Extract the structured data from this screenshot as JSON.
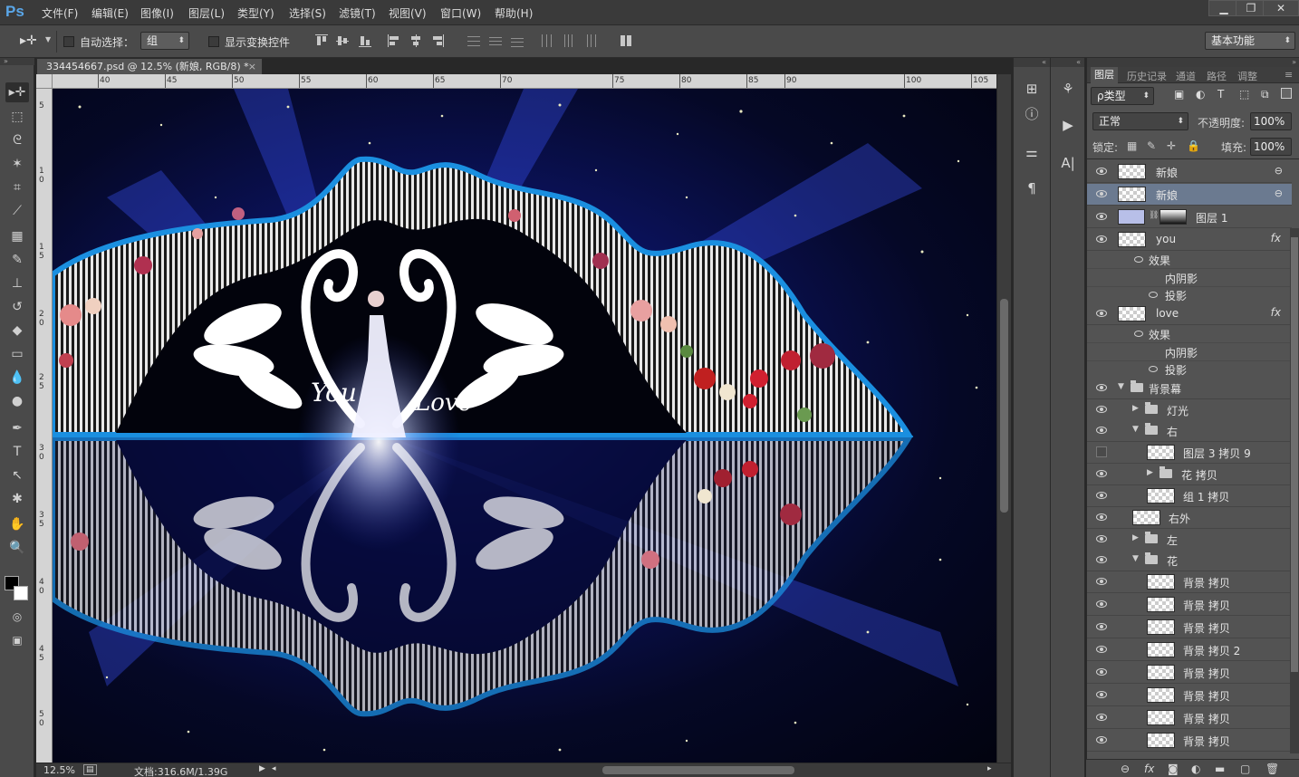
{
  "menubar": {
    "logo": "Ps",
    "items": [
      "文件(F)",
      "编辑(E)",
      "图像(I)",
      "图层(L)",
      "类型(Y)",
      "选择(S)",
      "滤镜(T)",
      "视图(V)",
      "窗口(W)",
      "帮助(H)"
    ],
    "window_buttons": [
      "minimize-icon",
      "restore-icon",
      "close-icon"
    ]
  },
  "options": {
    "auto_select_label": "自动选择：",
    "auto_select_value": "组",
    "show_transform_label": "显示变换控件",
    "workspace": "基本功能"
  },
  "document": {
    "tab_title": "334454667.psd @ 12.5% (新娘, RGB/8) *",
    "zoom": "12.5%",
    "doc_size": "文档:316.6M/1.39G"
  },
  "ruler": {
    "h_ticks": [
      "40",
      "45",
      "50",
      "55",
      "60",
      "65",
      "70",
      "75",
      "80",
      "85",
      "90",
      "100",
      "105"
    ],
    "v_ticks": [
      "5",
      "1\n0",
      "1\n5",
      "2\n0",
      "2\n5",
      "3\n0",
      "3\n5",
      "4\n0",
      "4\n5",
      "5\n0"
    ]
  },
  "layers_panel": {
    "tabs": [
      "图层",
      "历史记录",
      "通道",
      "路径",
      "调整"
    ],
    "filter_label": "ρ类型",
    "blend_mode": "正常",
    "opacity_label": "不透明度:",
    "opacity_value": "100%",
    "lock_label": "锁定:",
    "fill_label": "填充:",
    "fill_value": "100%",
    "rows": [
      {
        "name": "新娘",
        "kind": "layer",
        "eye": true
      },
      {
        "name": "新娘",
        "kind": "layer",
        "eye": true,
        "selected": true
      },
      {
        "name": "图层 1",
        "kind": "layer-mask",
        "eye": true
      },
      {
        "name": "you",
        "kind": "layer-fx",
        "eye": true
      },
      {
        "name": "效果",
        "kind": "effects"
      },
      {
        "name": "内阴影",
        "kind": "effect"
      },
      {
        "name": "投影",
        "kind": "effect-eye"
      },
      {
        "name": "love",
        "kind": "layer-fx",
        "eye": true
      },
      {
        "name": "效果",
        "kind": "effects"
      },
      {
        "name": "内阴影",
        "kind": "effect"
      },
      {
        "name": "投影",
        "kind": "effect-eye"
      },
      {
        "name": "背景幕",
        "kind": "group-open",
        "indent": 0,
        "eye": true
      },
      {
        "name": "灯光",
        "kind": "group-closed",
        "indent": 1,
        "eye": true
      },
      {
        "name": "右",
        "kind": "group-open",
        "indent": 1,
        "eye": true
      },
      {
        "name": "图层 3 拷贝 9",
        "kind": "layer",
        "indent": 2,
        "eye": false
      },
      {
        "name": "花 拷贝",
        "kind": "group-closed",
        "indent": 2,
        "eye": true
      },
      {
        "name": "组 1 拷贝",
        "kind": "layer",
        "indent": 2,
        "eye": true
      },
      {
        "name": "右外",
        "kind": "layer",
        "indent": 1,
        "eye": true
      },
      {
        "name": "左",
        "kind": "group-closed",
        "indent": 1,
        "eye": true
      },
      {
        "name": "花",
        "kind": "group-open",
        "indent": 1,
        "eye": true
      },
      {
        "name": "背景 拷贝",
        "kind": "layer",
        "indent": 2,
        "eye": true
      },
      {
        "name": "背景 拷贝",
        "kind": "layer",
        "indent": 2,
        "eye": true
      },
      {
        "name": "背景 拷贝",
        "kind": "layer",
        "indent": 2,
        "eye": true
      },
      {
        "name": "背景 拷贝 2",
        "kind": "layer",
        "indent": 2,
        "eye": true
      },
      {
        "name": "背景 拷贝",
        "kind": "layer",
        "indent": 2,
        "eye": true
      },
      {
        "name": "背景 拷贝",
        "kind": "layer",
        "indent": 2,
        "eye": true
      },
      {
        "name": "背景 拷贝",
        "kind": "layer",
        "indent": 2,
        "eye": true
      },
      {
        "name": "背景 拷贝",
        "kind": "layer",
        "indent": 2,
        "eye": true
      }
    ]
  },
  "canvas_text": {
    "left_script": "You",
    "right_script": "Love"
  },
  "colors": {
    "accent": "#5aa6e8",
    "frame_blue": "#1a8fe0",
    "selected_layer": "#6b7a90"
  }
}
